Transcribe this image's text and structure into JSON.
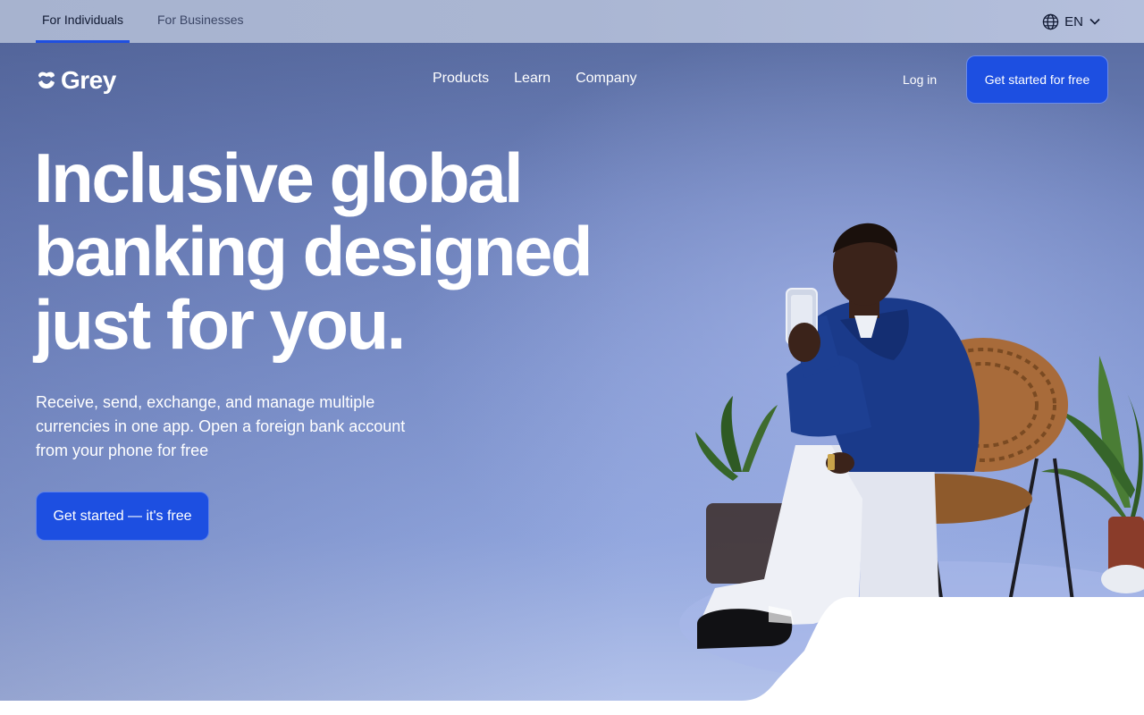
{
  "audience_tabs": [
    {
      "label": "For Individuals",
      "active": true
    },
    {
      "label": "For Businesses",
      "active": false
    }
  ],
  "language": {
    "code": "EN",
    "icon": "globe-icon",
    "caret": "chevron-down-icon"
  },
  "brand": {
    "name": "Grey",
    "logo_icon": "grey-logo-mark"
  },
  "nav": {
    "items": [
      "Products",
      "Learn",
      "Company"
    ],
    "login_label": "Log in",
    "cta_label": "Get started for free"
  },
  "hero": {
    "headline_lines": [
      "Inclusive global",
      "banking designed",
      "just for you."
    ],
    "subtitle": "Receive, send, exchange, and manage multiple currencies in one app. Open a foreign bank account from your phone for free",
    "cta_label": "Get started — it's free",
    "image": "man-seated-in-wicker-chair-holding-phone"
  },
  "colors": {
    "accent": "#1d4fe1",
    "topbar_bg": "#aab6d3",
    "hero_bg": "#7a8fc8",
    "text_light": "#ffffff",
    "text_dark": "#111a33"
  }
}
